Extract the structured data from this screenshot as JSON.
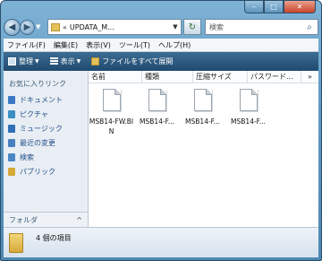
{
  "window": {
    "caption_buttons": {
      "minimize": "–",
      "maximize": "□",
      "close": "✕"
    }
  },
  "address": {
    "prefix": "«",
    "path": "UPDATA_M...",
    "search_placeholder": "検索"
  },
  "menu": [
    "ファイル(F)",
    "編集(E)",
    "表示(V)",
    "ツール(T)",
    "ヘルプ(H)"
  ],
  "toolbar": {
    "organize": "整理",
    "views": "表示",
    "burn": "ファイルをすべて展開"
  },
  "nav": {
    "favorites_title": "お気に入りリンク",
    "items": [
      {
        "label": "ドキュメント",
        "icon": "documents-icon",
        "color": "#3b78c4"
      },
      {
        "label": "ピクチャ",
        "icon": "pictures-icon",
        "color": "#3b8fc4"
      },
      {
        "label": "ミュージック",
        "icon": "music-icon",
        "color": "#2f6fb7"
      },
      {
        "label": "最近の変更",
        "icon": "recent-icon",
        "color": "#4a7fbf"
      },
      {
        "label": "検索",
        "icon": "search-folder-icon",
        "color": "#4a86c6"
      },
      {
        "label": "パブリック",
        "icon": "public-folder-icon",
        "color": "#d6a93a"
      }
    ],
    "folders_label": "フォルダ",
    "folders_caret": "^"
  },
  "columns": [
    "名前",
    "種類",
    "圧縮サイズ",
    "パスワード...",
    "»"
  ],
  "files": [
    {
      "name": "MSB14-FW.BIN"
    },
    {
      "name": "MSB14-F..."
    },
    {
      "name": "MSB14-F..."
    },
    {
      "name": "MSB14-F..."
    }
  ],
  "status": {
    "items_text": "4 個の項目"
  }
}
